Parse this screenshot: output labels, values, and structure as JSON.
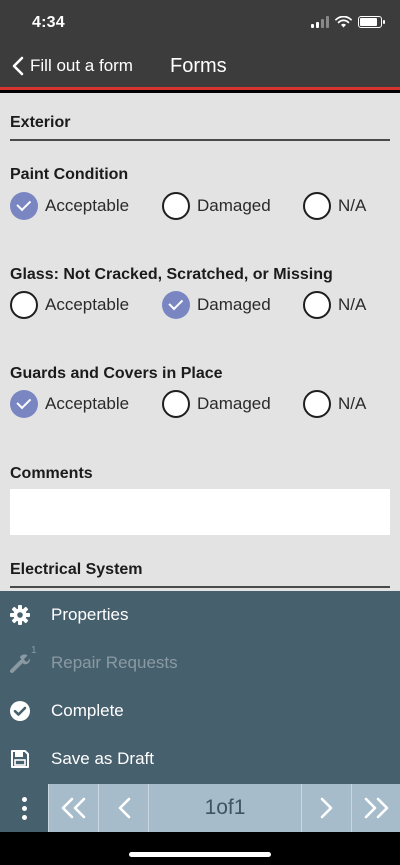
{
  "status_bar": {
    "time": "4:34"
  },
  "nav": {
    "back_label": "Fill out a form",
    "title": "Forms"
  },
  "form": {
    "section_exterior": "Exterior",
    "questions": [
      {
        "label": "Paint Condition",
        "options": [
          "Acceptable",
          "Damaged",
          "N/A"
        ],
        "selected": "Acceptable"
      },
      {
        "label": "Glass: Not Cracked, Scratched, or Missing",
        "options": [
          "Acceptable",
          "Damaged",
          "N/A"
        ],
        "selected": "Damaged"
      },
      {
        "label": "Guards and Covers in Place",
        "options": [
          "Acceptable",
          "Damaged",
          "N/A"
        ],
        "selected": "Acceptable"
      }
    ],
    "comments_label": "Comments",
    "comments_value": "",
    "section_electrical": "Electrical System"
  },
  "menu": {
    "items": [
      {
        "label": "Properties",
        "icon": "gear-icon",
        "enabled": true
      },
      {
        "label": "Repair Requests",
        "icon": "wrench-icon",
        "enabled": false,
        "badge": "1"
      },
      {
        "label": "Complete",
        "icon": "check-circle-icon",
        "enabled": true
      },
      {
        "label": "Save as Draft",
        "icon": "save-icon",
        "enabled": true
      }
    ]
  },
  "pager": {
    "page_text": "1of1"
  },
  "colors": {
    "nav_bg": "#3c3c3c",
    "accent_line": "#d6342c",
    "form_bg": "#e3e3e3",
    "radio_checked": "#7a86c2",
    "menu_bg": "#47606e",
    "pager_btn": "#a7bccb"
  }
}
